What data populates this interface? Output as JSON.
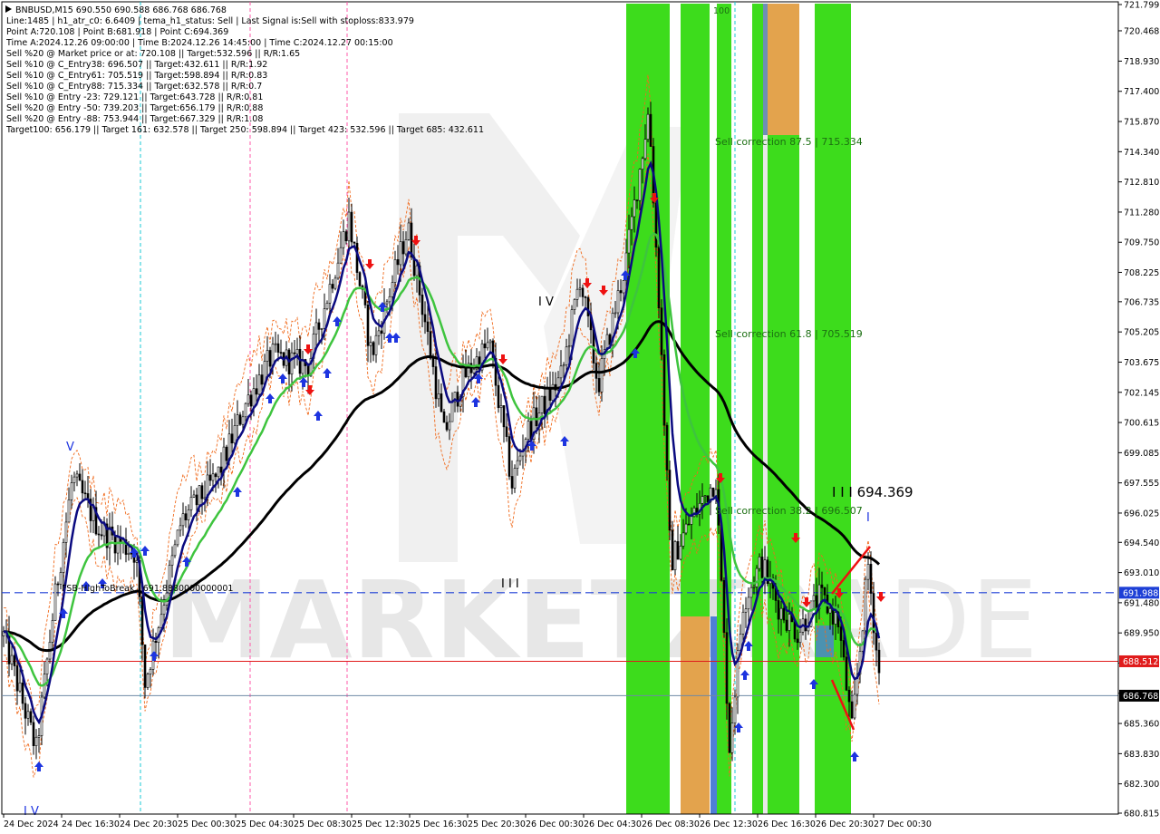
{
  "chart_data": {
    "type": "candlestick",
    "symbol_line": "BNBUSD,M15  690.550 690.588 686.768 686.768",
    "info_lines": [
      "Line:1485 | h1_atr_c0: 6.6409 | tema_h1_status: Sell | Last Signal is:Sell with stoploss:833.979",
      "Point A:720.108 | Point B:681.918 | Point C:694.369",
      "Time A:2024.12.26 09:00:00 | Time B:2024.12.26 14:45:00 | Time C:2024.12.27 00:15:00",
      "Sell %20 @ Market price or at: 720.108 || Target:532.596 || R/R:1.65",
      "Sell %10 @ C_Entry38: 696.507 || Target:432.611 || R/R:1.92",
      "Sell %10 @ C_Entry61: 705.519 || Target:598.894 || R/R:0.83",
      "Sell %10 @ C_Entry88: 715.334 || Target:632.578 || R/R:0.7",
      "Sell %10 @ Entry -23: 729.121 || Target:643.728 || R/R:0.81",
      "Sell %20 @ Entry -50: 739.203 || Target:656.179 || R/R:0.88",
      "Sell %20 @ Entry -88: 753.944 || Target:667.329 || R/R:1.08",
      "Target100: 656.179 || Target 161: 632.578 || Target 250: 598.894 || Target 423: 532.596 || Target 685: 432.611"
    ],
    "y_ticks": [
      "721.799",
      "720.468",
      "718.930",
      "717.400",
      "715.870",
      "714.340",
      "712.810",
      "711.280",
      "709.750",
      "708.225",
      "706.735",
      "705.205",
      "703.675",
      "702.145",
      "700.615",
      "699.085",
      "697.555",
      "696.025",
      "694.540",
      "693.010",
      "691.480",
      "689.950",
      "688.420",
      "686.890",
      "685.360",
      "683.830",
      "682.300",
      "680.815"
    ],
    "x_ticks": [
      "24 Dec 2024",
      "24 Dec 16:30",
      "24 Dec 20:30",
      "25 Dec 00:30",
      "25 Dec 04:30",
      "25 Dec 08:30",
      "25 Dec 12:30",
      "25 Dec 16:30",
      "25 Dec 20:30",
      "26 Dec 00:30",
      "26 Dec 04:30",
      "26 Dec 08:30",
      "26 Dec 12:30",
      "26 Dec 16:30",
      "26 Dec 20:30",
      "27 Dec 00:30"
    ],
    "ylim": [
      680.815,
      721.799
    ],
    "price_labels": [
      {
        "value": 691.988,
        "text": "691.988",
        "color": "#1d3fd6"
      },
      {
        "value": 688.512,
        "text": "688.512",
        "color": "#e01b1b"
      },
      {
        "value": 686.768,
        "text": "686.768",
        "color": "#000000"
      }
    ],
    "annotations": {
      "corr_87": "Sell correction 87.5 | 715.334",
      "corr_61": "Sell correction 61.8 | 705.519",
      "corr_38": "Sell correction 38.2 | 696.507",
      "point_c": "I I I 694.369",
      "fsb": "FSB-HighToBreak | 691.8880000000001",
      "label_100": "100",
      "wave_v": "V",
      "wave_iv": "I V",
      "wave_iii": "I I I",
      "wave_iv_bottom": "I V",
      "wave_i": "I"
    },
    "colors": {
      "bull": "#ffffff",
      "bear": "#000000",
      "ema_fast": "#0a0a80",
      "ema_mid": "#3ec43e",
      "ema_slow": "#000000",
      "envelope": "#f06a1c",
      "zone_green": "#3ddc1c",
      "zone_orange": "#e3a34d",
      "zone_blue": "#4f7fd6",
      "sell_arrow": "#ee1111",
      "buy_arrow": "#1d34e0"
    },
    "watermark": "MARKETZI",
    "watermark_tail": "TRADE"
  }
}
